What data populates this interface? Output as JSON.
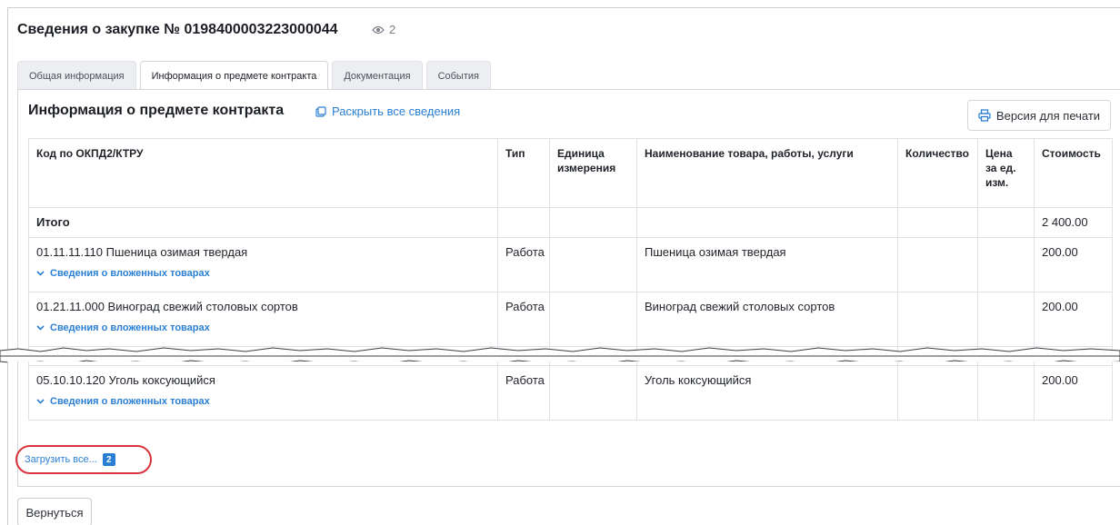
{
  "header": {
    "title": "Сведения о закупке № 0198400003223000044",
    "views_count": "2",
    "views_icon": "eye-icon"
  },
  "tabs": [
    {
      "label": "Общая информация",
      "active": false
    },
    {
      "label": "Информация о предмете контракта",
      "active": true
    },
    {
      "label": "Документация",
      "active": false
    },
    {
      "label": "События",
      "active": false
    }
  ],
  "section": {
    "title": "Информация о предмете контракта",
    "expand_label": "Раскрыть все сведения",
    "print_label": "Версия для печати"
  },
  "table": {
    "headers": {
      "code": "Код по ОКПД2/КТРУ",
      "type": "Тип",
      "unit": "Единица измерения",
      "name": "Наименование товара, работы, услуги",
      "qty": "Количество",
      "price": "Цена за ед. изм.",
      "cost": "Стоимость"
    },
    "total": {
      "label": "Итого",
      "cost": "2 400.00"
    },
    "rows": [
      {
        "code": "01.11.11.110 Пшеница озимая твердая",
        "type": "Работа",
        "name": "Пшеница озимая твердая",
        "cost": "200.00",
        "sub_label": "Сведения о вложенных товарах"
      },
      {
        "code": "01.21.11.000 Виноград свежий столовых сортов",
        "type": "Работа",
        "name": "Виноград свежий столовых сортов",
        "cost": "200.00",
        "sub_label": "Сведения о вложенных товарах"
      },
      {
        "code": "05.10.10.120 Уголь коксующийся",
        "type": "Работа",
        "name": "Уголь коксующийся",
        "cost": "200.00",
        "sub_label": "Сведения о вложенных товарах"
      }
    ]
  },
  "load_all": {
    "label": "Загрузить все...",
    "count": "2"
  },
  "back_label": "Вернуться",
  "colors": {
    "accent": "#2a7fd4",
    "highlight": "#d9343b"
  }
}
